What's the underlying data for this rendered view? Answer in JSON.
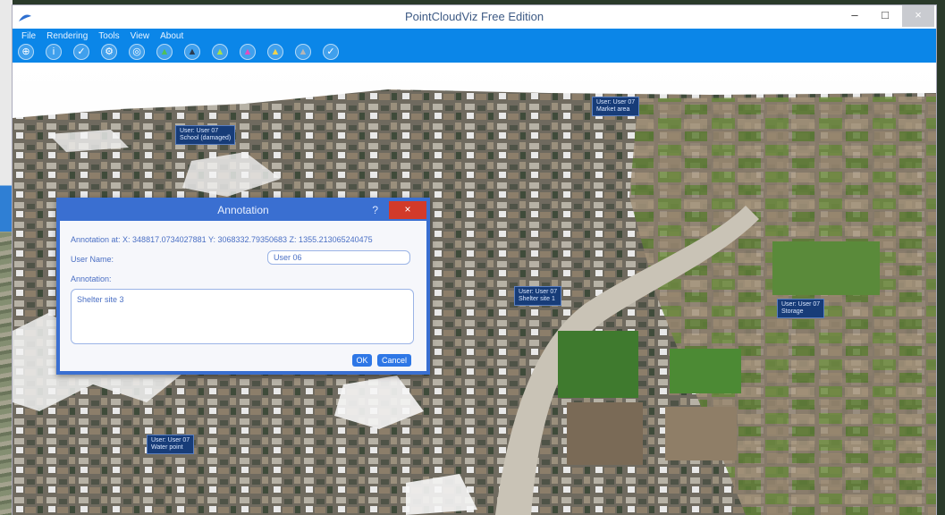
{
  "window": {
    "title": "PointCloudViz Free Edition",
    "min": "–",
    "max": "□",
    "close": "×"
  },
  "menu": [
    "File",
    "Rendering",
    "Tools",
    "View",
    "About"
  ],
  "toolbar": [
    {
      "icon": "zoom-icon",
      "glyph": "⊕"
    },
    {
      "icon": "info-icon",
      "glyph": "i"
    },
    {
      "icon": "check-icon",
      "glyph": "✓"
    },
    {
      "icon": "settings-icon",
      "glyph": "⚙"
    },
    {
      "icon": "globe-icon",
      "glyph": "◎"
    },
    {
      "icon": "landmark-green-icon",
      "glyph": "▲"
    },
    {
      "icon": "landmark-dark-icon",
      "glyph": "▲"
    },
    {
      "icon": "landmark-lime-icon",
      "glyph": "▲"
    },
    {
      "icon": "landmark-magenta-icon",
      "glyph": "▲"
    },
    {
      "icon": "landmark-yellow-icon",
      "glyph": "▲"
    },
    {
      "icon": "landmark-grey-icon",
      "glyph": "▲"
    },
    {
      "icon": "check-circle-icon",
      "glyph": "✓"
    }
  ],
  "annotations": [
    {
      "text": "User: User 07\nMarket area"
    },
    {
      "text": "User: User 07\nSchool (damaged)"
    },
    {
      "text": "User: User 07\nShelter site 1"
    },
    {
      "text": "User: User 07\nStorage"
    },
    {
      "text": "User: User 07\nWater point"
    }
  ],
  "dialog": {
    "title": "Annotation",
    "help": "?",
    "close": "×",
    "annotation_at": "Annotation at:  X: 348817.0734027881 Y: 3068332.79350683 Z: 1355.213065240475",
    "user_name_label": "User Name:",
    "user_name_value": "User 06",
    "annotation_label": "Annotation:",
    "annotation_value": "Shelter site 3",
    "ok": "OK",
    "cancel": "Cancel"
  },
  "colors": {
    "ribbon": "#0b86e8",
    "dialog_border": "#3a6fd1",
    "close": "#d23a2a"
  }
}
